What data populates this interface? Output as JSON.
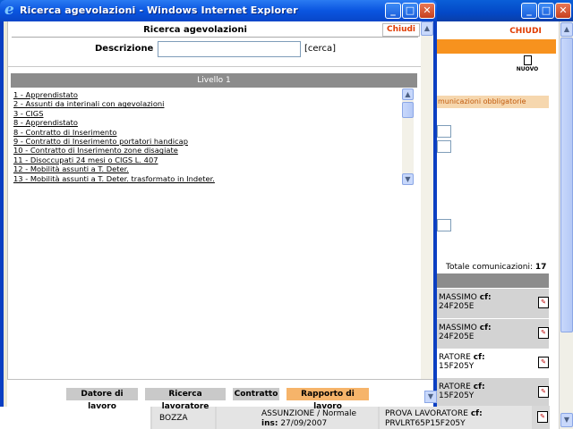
{
  "popup": {
    "window_title": "Ricerca agevolazioni - Windows Internet Explorer",
    "browser_icon": "ie-icon",
    "header_title": "Ricerca agevolazioni",
    "close_link": "Chiudi",
    "search_label": "Descrizione",
    "search_value": "",
    "search_placeholder": "",
    "search_link": "[cerca]",
    "level_header": "Livello 1",
    "list_items": [
      "1 - Apprendistato",
      "2 - Assunti da interinali con agevolazioni",
      "3 - CIGS",
      "8 - Apprendistato",
      "8 - Contratto di Inserimento",
      "9 - Contratto di Inserimento portatori handicap",
      "10 - Contratto di Inserimento zone disagiate",
      "11 - Disoccupati 24 mesi o CIGS L. 407",
      "12 - Mobilità assunti a T. Deter.",
      "13 - Mobilità assunti a T. Deter. trasformato in Indeter."
    ],
    "footer_tabs": [
      "Datore di lavoro",
      "Ricerca lavoratore",
      "Contratto",
      "Rapporto di lavoro"
    ],
    "active_tab_index": 3
  },
  "background": {
    "close_link": "CHIUDI",
    "new_label": "NUOVO",
    "comm_tab": "municazioni obbligatorie",
    "total_label": "Totale comunicazioni:",
    "total_value": "17",
    "rows": [
      {
        "name": "MASSIMO",
        "cf_label": "cf:",
        "cf": "24F205E"
      },
      {
        "name": "MASSIMO",
        "cf_label": "cf:",
        "cf": "24F205E"
      },
      {
        "name": "RATORE",
        "cf_label": "cf:",
        "cf": "15F205Y"
      },
      {
        "name": "RATORE",
        "cf_label": "cf:",
        "cf": "15F205Y"
      }
    ],
    "bottom_row": {
      "state": "BOZZA",
      "type": "ASSUNZIONE / Normale",
      "ins_label": "ins:",
      "ins_date": "27/09/2007",
      "worker": "PROVA LAVORATORE",
      "cf_label": "cf:",
      "cf": "PRVLRT65P15F205Y"
    }
  },
  "colors": {
    "accent_orange": "#f7921e",
    "close_red": "#e03b00",
    "active_tab": "#f6b46a",
    "xp_title_blue": "#0a55e0"
  }
}
